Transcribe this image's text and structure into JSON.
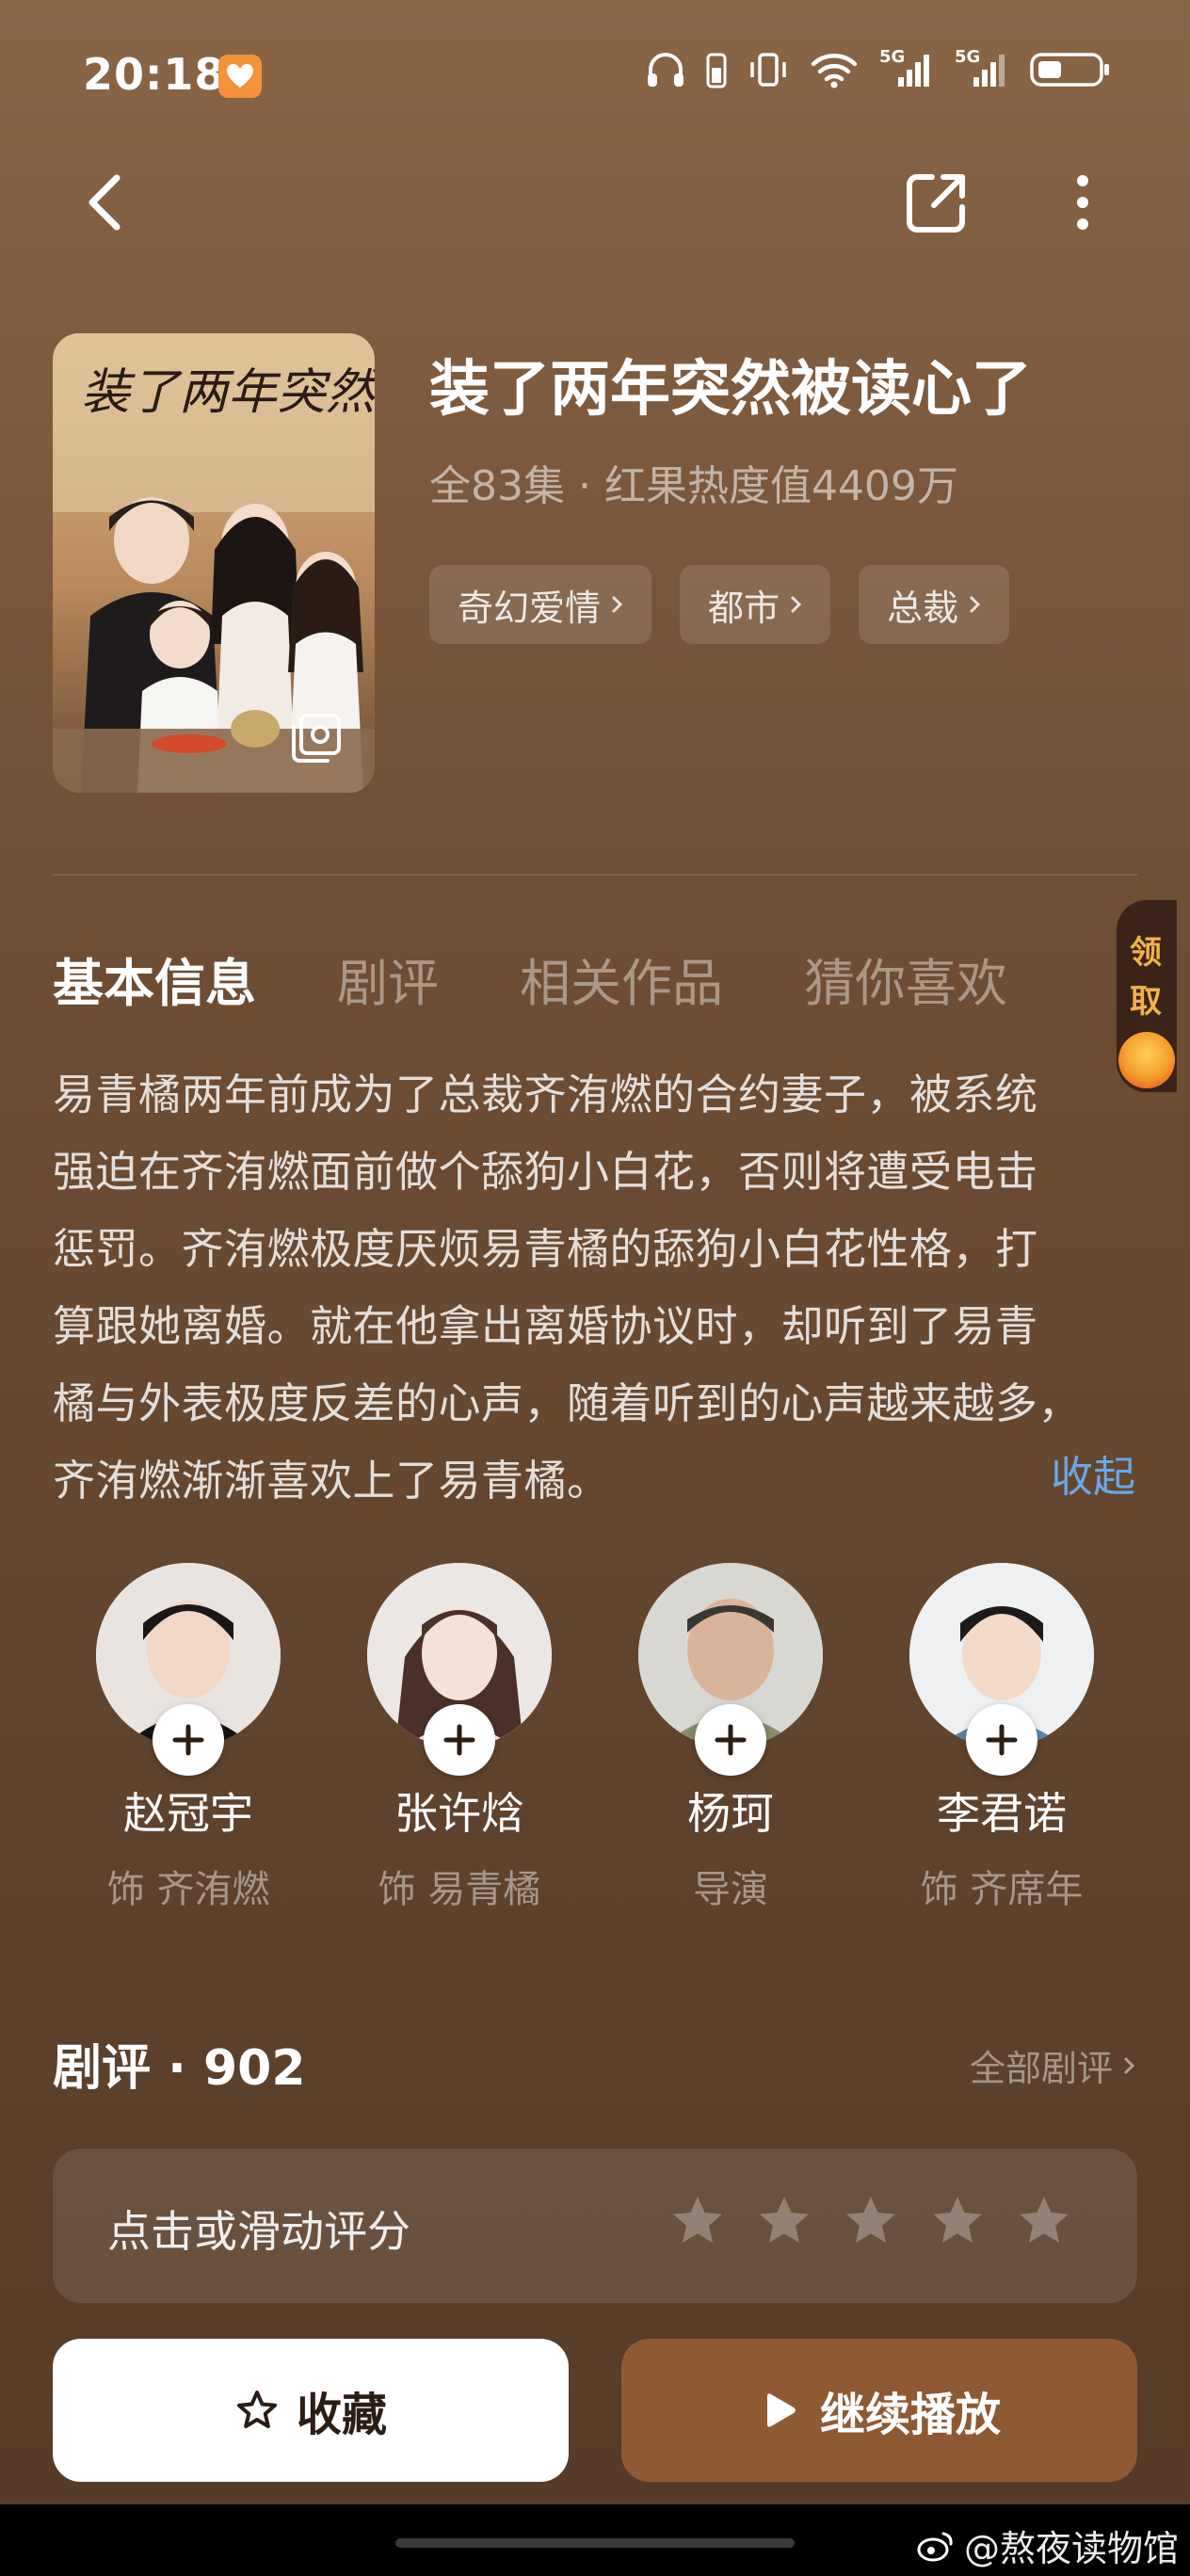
{
  "status_bar": {
    "time": "20:18",
    "network_1": "5G",
    "network_2": "5G"
  },
  "header": {
    "back_icon": "chevron-left-icon",
    "share_icon": "share-icon",
    "more_icon": "more-vertical-icon"
  },
  "show": {
    "poster_title_art": "装了两年突然被读心了",
    "title": "装了两年突然被读心了",
    "meta": "全83集 · 红果热度值4409万",
    "tags": [
      {
        "label": "奇幻爱情"
      },
      {
        "label": "都市"
      },
      {
        "label": "总裁"
      }
    ]
  },
  "tabs": [
    {
      "label": "基本信息",
      "active": true
    },
    {
      "label": "剧评",
      "active": false
    },
    {
      "label": "相关作品",
      "active": false
    },
    {
      "label": "猜你喜欢",
      "active": false
    }
  ],
  "claim_widget": {
    "line1": "领",
    "line2": "取"
  },
  "synopsis": {
    "lines": [
      "易青橘两年前成为了总裁齐洧燃的合约妻子，被系统",
      "强迫在齐洧燃面前做个舔狗小白花，否则将遭受电击",
      "惩罚。齐洧燃极度厌烦易青橘的舔狗小白花性格，打",
      "算跟她离婚。就在他拿出离婚协议时，却听到了易青",
      "橘与外表极度反差的心声，随着听到的心声越来越多，",
      "齐洧燃渐渐喜欢上了易青橘。"
    ],
    "collapse_label": "收起"
  },
  "cast": [
    {
      "name": "赵冠宇",
      "role": "饰 齐洧燃"
    },
    {
      "name": "张许焓",
      "role": "饰 易青橘"
    },
    {
      "name": "杨珂",
      "role": "导演"
    },
    {
      "name": "李君诺",
      "role": "饰 齐席年"
    }
  ],
  "reviews": {
    "title": "剧评 · 902",
    "all_label": "全部剧评",
    "rate_prompt": "点击或滑动评分",
    "star_count": 5
  },
  "actions": {
    "favorite_label": "收藏",
    "play_label": "继续播放"
  },
  "watermark": "@熬夜读物馆",
  "colors": {
    "accent_link": "#6aa7e8",
    "play_button": "#8e5a34",
    "claim_text": "#f0b24a"
  }
}
